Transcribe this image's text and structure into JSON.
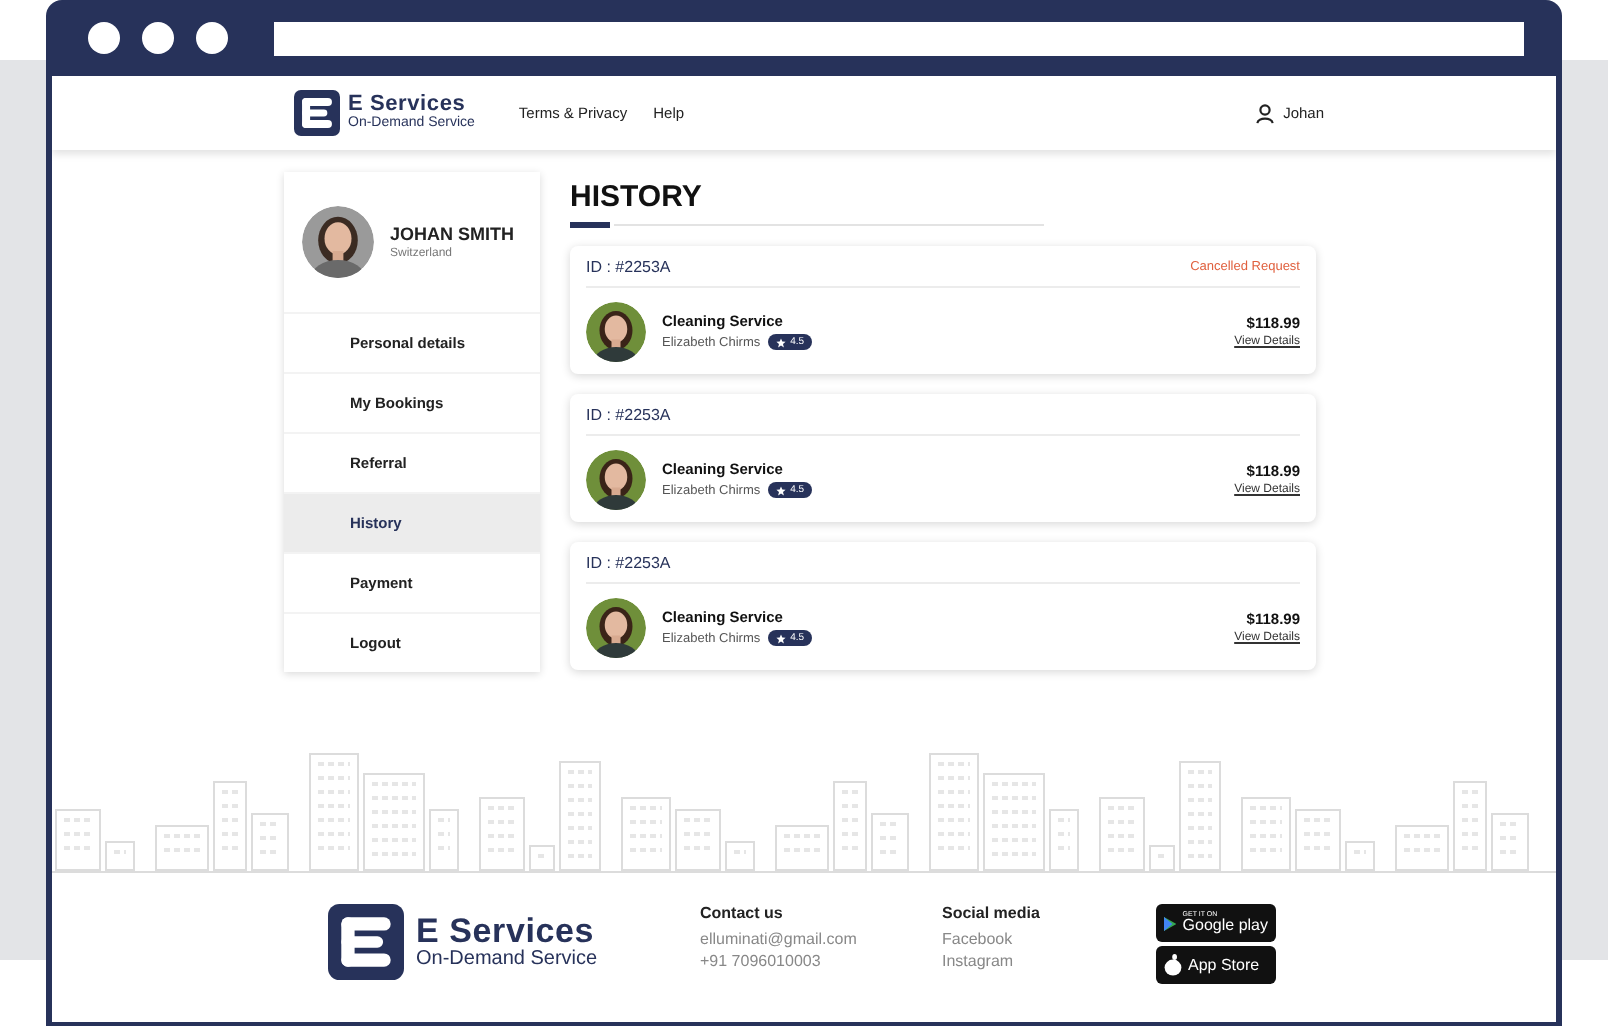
{
  "header": {
    "brand": {
      "name": "E Services",
      "tagline": "On-Demand Service"
    },
    "nav": [
      "Terms & Privacy",
      "Help"
    ],
    "user": "Johan"
  },
  "profile": {
    "name": "JOHAN SMITH",
    "location": "Switzerland"
  },
  "menu": [
    {
      "label": "Personal details",
      "selected": false
    },
    {
      "label": "My Bookings",
      "selected": false
    },
    {
      "label": "Referral",
      "selected": false
    },
    {
      "label": "History",
      "selected": true
    },
    {
      "label": "Payment",
      "selected": false
    },
    {
      "label": "Logout",
      "selected": false
    }
  ],
  "history": {
    "title": "HISTORY",
    "orders": [
      {
        "id": "ID : #2253A",
        "status": "Cancelled Request",
        "service": "Cleaning Service",
        "provider": "Elizabeth Chirms",
        "rating": "4.5",
        "price": "$118.99",
        "link": "View Details"
      },
      {
        "id": "ID : #2253A",
        "service": "Cleaning Service",
        "provider": "Elizabeth Chirms",
        "rating": "4.5",
        "price": "$118.99",
        "link": "View Details"
      },
      {
        "id": "ID : #2253A",
        "service": "Cleaning Service",
        "provider": "Elizabeth Chirms",
        "rating": "4.5",
        "price": "$118.99",
        "link": "View Details"
      }
    ]
  },
  "footer": {
    "brand": {
      "name": "E Services",
      "tagline": "On-Demand Service"
    },
    "contact": {
      "title": "Contact us",
      "lines": [
        "elluminati@gmail.com",
        "+91 7096010003"
      ]
    },
    "social": {
      "title": "Social media",
      "links": [
        "Facebook",
        "Instagram"
      ]
    },
    "stores": [
      {
        "kind": "google",
        "small": "GET IT ON",
        "label": "Google play"
      },
      {
        "kind": "apple",
        "label": "App Store"
      }
    ]
  }
}
